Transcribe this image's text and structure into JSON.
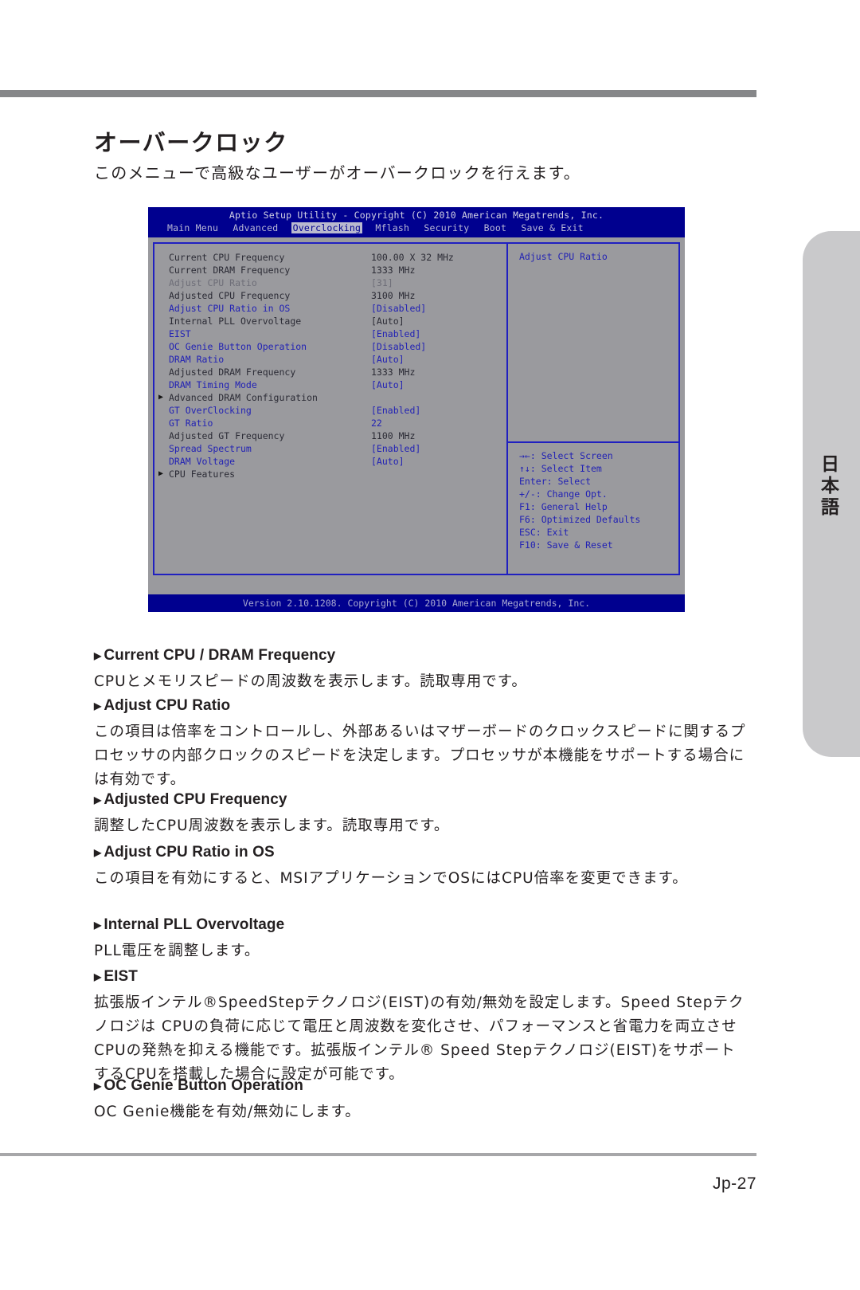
{
  "page": {
    "title": "オーバークロック",
    "lead": "このメニューで高級なユーザーがオーバークロックを行えます。",
    "folio": "Jp-27",
    "side_tab_label": "日本語",
    "rule_color": "#868789"
  },
  "bios": {
    "title": "Aptio Setup Utility - Copyright (C) 2010 American Megatrends, Inc.",
    "menu": [
      {
        "label": "Main Menu",
        "active": false
      },
      {
        "label": "Advanced",
        "active": false
      },
      {
        "label": "Overclocking",
        "active": true
      },
      {
        "label": "Mflash",
        "active": false
      },
      {
        "label": "Security",
        "active": false
      },
      {
        "label": "Boot",
        "active": false
      },
      {
        "label": "Save & Exit",
        "active": false
      }
    ],
    "items": [
      {
        "name": "Current CPU Frequency",
        "value": "100.00 X 32 MHz",
        "style": "dark",
        "submenu": false
      },
      {
        "name": "Current DRAM Frequency",
        "value": "1333 MHz",
        "style": "dark",
        "submenu": false
      },
      {
        "name": "Adjust CPU Ratio",
        "value": "[31]",
        "style": "grey",
        "submenu": false
      },
      {
        "name": "Adjusted CPU Frequency",
        "value": "3100 MHz",
        "style": "dark",
        "submenu": false
      },
      {
        "name": "Adjust CPU Ratio in OS",
        "value": "[Disabled]",
        "style": "blue",
        "submenu": false
      },
      {
        "name": "Internal PLL Overvoltage",
        "value": "[Auto]",
        "style": "dark",
        "submenu": false
      },
      {
        "name": "EIST",
        "value": "[Enabled]",
        "style": "blue",
        "submenu": false
      },
      {
        "name": "OC Genie Button Operation",
        "value": "[Disabled]",
        "style": "blue",
        "submenu": false
      },
      {
        "name": "DRAM Ratio",
        "value": "[Auto]",
        "style": "blue",
        "submenu": false
      },
      {
        "name": "Adjusted DRAM Frequency",
        "value": "1333 MHz",
        "style": "dark",
        "submenu": false
      },
      {
        "name": "DRAM Timing Mode",
        "value": "[Auto]",
        "style": "blue",
        "submenu": false
      },
      {
        "name": "Advanced DRAM Configuration",
        "value": "",
        "style": "dark",
        "submenu": true
      },
      {
        "name": "GT OverClocking",
        "value": "[Enabled]",
        "style": "blue",
        "submenu": false
      },
      {
        "name": "GT Ratio",
        "value": "22",
        "style": "blue",
        "submenu": false
      },
      {
        "name": "Adjusted GT Frequency",
        "value": "1100 MHz",
        "style": "dark",
        "submenu": false
      },
      {
        "name": "Spread Spectrum",
        "value": "[Enabled]",
        "style": "blue",
        "submenu": false
      },
      {
        "name": "DRAM Voltage",
        "value": "[Auto]",
        "style": "blue",
        "submenu": false
      },
      {
        "name": "CPU Features",
        "value": "",
        "style": "dark",
        "submenu": true
      }
    ],
    "help_title": "Adjust CPU Ratio",
    "keys": [
      "→←: Select Screen",
      "↑↓: Select Item",
      "Enter: Select",
      "+/-: Change Opt.",
      "F1: General Help",
      "F6: Optimized Defaults",
      "ESC: Exit",
      "F10: Save & Reset"
    ],
    "footer": "Version 2.10.1208. Copyright (C) 2010 American Megatrends, Inc."
  },
  "sections": [
    {
      "heading": "Current CPU / DRAM Frequency",
      "body": "CPUとメモリスピードの周波数を表示します。読取専用です。"
    },
    {
      "heading": "Adjust CPU Ratio",
      "body": "この項目は倍率をコントロールし、外部あるいはマザーボードのクロックスピードに関するプロセッサの内部クロックのスピードを決定します。プロセッサが本機能をサポートする場合には有効です。"
    },
    {
      "heading": "Adjusted CPU Frequency",
      "body": "調整したCPU周波数を表示します。読取専用です。"
    },
    {
      "heading": "Adjust CPU Ratio in OS",
      "body": "この項目を有効にすると、MSIアプリケーションでOSにはCPU倍率を変更できます。"
    },
    {
      "heading": "Internal PLL Overvoltage",
      "body": "PLL電圧を調整します。"
    },
    {
      "heading": "EIST",
      "body": "拡張版インテル®SpeedStepテクノロジ(EIST)の有効/無効を設定します。Speed Stepテクノロジは CPUの負荷に応じて電圧と周波数を変化させ、パフォーマンスと省電力を両立させCPUの発熱を抑える機能です。拡張版インテル® Speed Stepテクノロジ(EIST)をサポートするCPUを搭載した場合に設定が可能です。"
    },
    {
      "heading": "OC Genie Button Operation",
      "body": "OC Genie機能を有効/無効にします。"
    }
  ],
  "colors": {
    "bios_blue": "#00008f",
    "bios_grey": "#9a9a9e",
    "bios_border": "#2020c0",
    "text_blue": "#2222b4"
  }
}
